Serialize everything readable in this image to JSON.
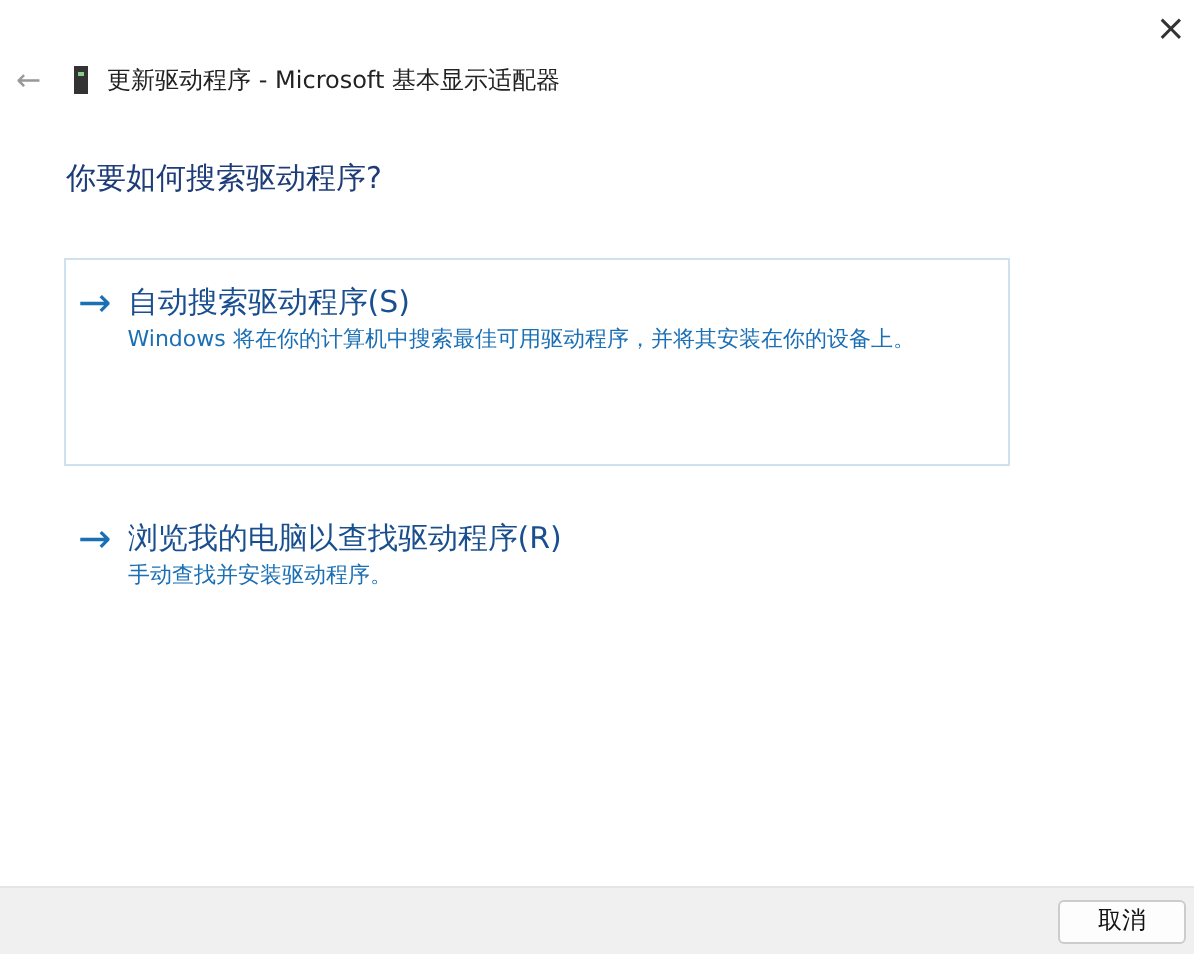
{
  "window": {
    "close": "×"
  },
  "header": {
    "back": "←",
    "title": "更新驱动程序 - Microsoft 基本显示适配器"
  },
  "heading": "你要如何搜索驱动程序?",
  "options": [
    {
      "arrow": "→",
      "title": "自动搜索驱动程序(S)",
      "description": "Windows 将在你的计算机中搜索最佳可用驱动程序，并将其安装在你的设备上。",
      "selected": true
    },
    {
      "arrow": "→",
      "title": "浏览我的电脑以查找驱动程序(R)",
      "description": "手动查找并安装驱动程序。",
      "selected": false
    }
  ],
  "buttons": [
    "取消"
  ]
}
